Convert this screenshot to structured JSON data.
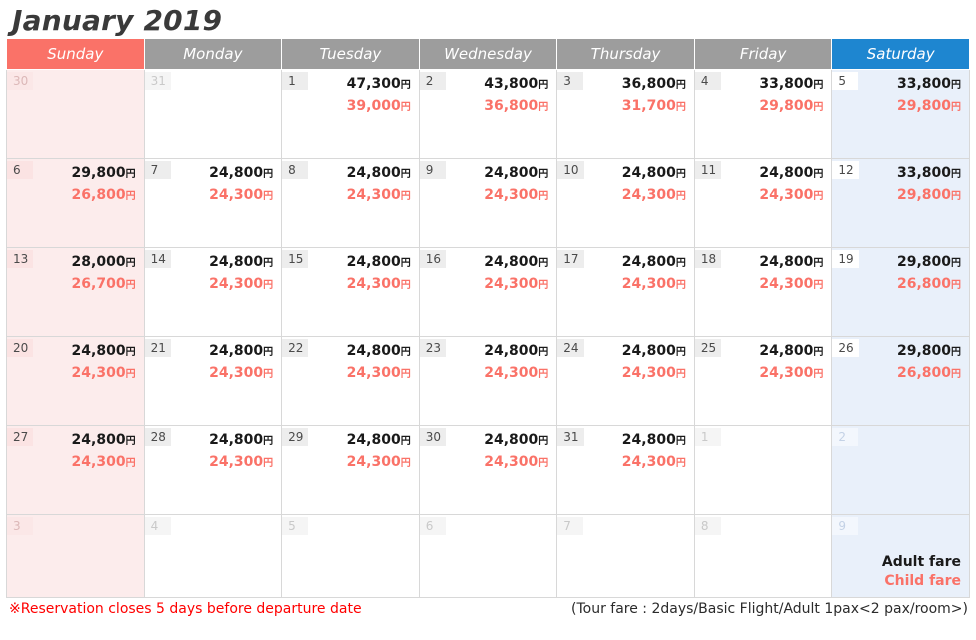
{
  "title": "January 2019",
  "colors": {
    "sunday_header": "#fa7268",
    "saturday_header": "#1e86d0",
    "weekday_header": "#9d9d9d",
    "adult_fare": "#1a1a1a",
    "child_fare": "#fa7268",
    "note": "#ff0000"
  },
  "weekdays": [
    {
      "label": "Sunday"
    },
    {
      "label": "Monday"
    },
    {
      "label": "Tuesday"
    },
    {
      "label": "Wednesday"
    },
    {
      "label": "Thursday"
    },
    {
      "label": "Friday"
    },
    {
      "label": "Saturday"
    }
  ],
  "yen_symbol": "円",
  "legend": {
    "adult": "Adult fare",
    "child": "Child fare"
  },
  "footer": {
    "note": "※Reservation closes 5 days before departure date",
    "tour": "(Tour fare : 2days/Basic Flight/Adult 1pax<2 pax/room>)"
  },
  "weeks": [
    [
      {
        "day": "30",
        "muted": true,
        "adult": "",
        "child": ""
      },
      {
        "day": "31",
        "muted": true,
        "adult": "",
        "child": ""
      },
      {
        "day": "1",
        "muted": false,
        "adult": "47,300",
        "child": "39,000"
      },
      {
        "day": "2",
        "muted": false,
        "adult": "43,800",
        "child": "36,800"
      },
      {
        "day": "3",
        "muted": false,
        "adult": "36,800",
        "child": "31,700"
      },
      {
        "day": "4",
        "muted": false,
        "adult": "33,800",
        "child": "29,800"
      },
      {
        "day": "5",
        "muted": false,
        "adult": "33,800",
        "child": "29,800"
      }
    ],
    [
      {
        "day": "6",
        "muted": false,
        "adult": "29,800",
        "child": "26,800"
      },
      {
        "day": "7",
        "muted": false,
        "adult": "24,800",
        "child": "24,300"
      },
      {
        "day": "8",
        "muted": false,
        "adult": "24,800",
        "child": "24,300"
      },
      {
        "day": "9",
        "muted": false,
        "adult": "24,800",
        "child": "24,300"
      },
      {
        "day": "10",
        "muted": false,
        "adult": "24,800",
        "child": "24,300"
      },
      {
        "day": "11",
        "muted": false,
        "adult": "24,800",
        "child": "24,300"
      },
      {
        "day": "12",
        "muted": false,
        "adult": "33,800",
        "child": "29,800"
      }
    ],
    [
      {
        "day": "13",
        "muted": false,
        "adult": "28,000",
        "child": "26,700"
      },
      {
        "day": "14",
        "muted": false,
        "adult": "24,800",
        "child": "24,300"
      },
      {
        "day": "15",
        "muted": false,
        "adult": "24,800",
        "child": "24,300"
      },
      {
        "day": "16",
        "muted": false,
        "adult": "24,800",
        "child": "24,300"
      },
      {
        "day": "17",
        "muted": false,
        "adult": "24,800",
        "child": "24,300"
      },
      {
        "day": "18",
        "muted": false,
        "adult": "24,800",
        "child": "24,300"
      },
      {
        "day": "19",
        "muted": false,
        "adult": "29,800",
        "child": "26,800"
      }
    ],
    [
      {
        "day": "20",
        "muted": false,
        "adult": "24,800",
        "child": "24,300"
      },
      {
        "day": "21",
        "muted": false,
        "adult": "24,800",
        "child": "24,300"
      },
      {
        "day": "22",
        "muted": false,
        "adult": "24,800",
        "child": "24,300"
      },
      {
        "day": "23",
        "muted": false,
        "adult": "24,800",
        "child": "24,300"
      },
      {
        "day": "24",
        "muted": false,
        "adult": "24,800",
        "child": "24,300"
      },
      {
        "day": "25",
        "muted": false,
        "adult": "24,800",
        "child": "24,300"
      },
      {
        "day": "26",
        "muted": false,
        "adult": "29,800",
        "child": "26,800"
      }
    ],
    [
      {
        "day": "27",
        "muted": false,
        "adult": "24,800",
        "child": "24,300"
      },
      {
        "day": "28",
        "muted": false,
        "adult": "24,800",
        "child": "24,300"
      },
      {
        "day": "29",
        "muted": false,
        "adult": "24,800",
        "child": "24,300"
      },
      {
        "day": "30",
        "muted": false,
        "adult": "24,800",
        "child": "24,300"
      },
      {
        "day": "31",
        "muted": false,
        "adult": "24,800",
        "child": "24,300"
      },
      {
        "day": "1",
        "muted": true,
        "adult": "",
        "child": ""
      },
      {
        "day": "2",
        "muted": true,
        "adult": "",
        "child": ""
      }
    ],
    [
      {
        "day": "3",
        "muted": true,
        "adult": "",
        "child": ""
      },
      {
        "day": "4",
        "muted": true,
        "adult": "",
        "child": ""
      },
      {
        "day": "5",
        "muted": true,
        "adult": "",
        "child": ""
      },
      {
        "day": "6",
        "muted": true,
        "adult": "",
        "child": ""
      },
      {
        "day": "7",
        "muted": true,
        "adult": "",
        "child": ""
      },
      {
        "day": "8",
        "muted": true,
        "adult": "",
        "child": ""
      },
      {
        "day": "9",
        "muted": true,
        "adult": "",
        "child": ""
      }
    ]
  ]
}
